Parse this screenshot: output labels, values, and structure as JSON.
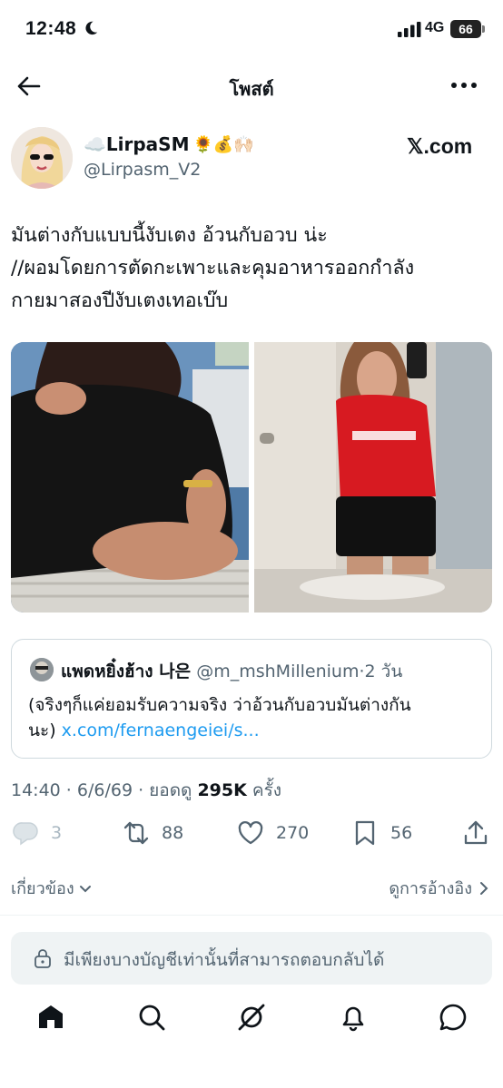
{
  "status_bar": {
    "time": "12:48",
    "network": "4G",
    "battery": "66"
  },
  "header": {
    "title": "โพสต์"
  },
  "author": {
    "name": "☁️LirpaSM",
    "name_emojis": "🌻💰🙌🏻",
    "handle": "@Lirpasm_V2"
  },
  "watermark": "𝕏.com",
  "tweet": {
    "text": "มันต่างกับแบบนี้งับเตง อ้วนกับอวบ น่ะ\n//ผอมโดยการตัดกะเพาะและคุมอาหารออกกำลัง\nกายมาสองปีงับเตงเทอเบ๊บ"
  },
  "quote": {
    "name": "แพดหยิ๋งฮ้าง 나은",
    "handle": "@m_mshMillenium",
    "separator": "·",
    "age": "2 วัน",
    "text": "(จริงๆก็แค่ยอมรับความจริง ว่าอ้วนกับอวบมันต่างกัน\nนะ) ",
    "link": "x.com/fernaengeiei/s..."
  },
  "meta": {
    "time": "14:40",
    "date": "6/6/69",
    "views_label": "ยอดดู",
    "views_count": "295K",
    "views_suffix": "ครั้ง",
    "sep": " · "
  },
  "actions": {
    "replies": "3",
    "reposts": "88",
    "likes": "270",
    "bookmarks": "56"
  },
  "related": {
    "label": "เกี่ยวข้อง",
    "quotes_label": "ดูการอ้างอิง"
  },
  "reply_box": {
    "placeholder": "มีเพียงบางบัญชีเท่านั้นที่สามารถตอบกลับได้"
  },
  "colors": {
    "text": "#0f1419",
    "muted": "#536471",
    "link": "#1d9bf0",
    "border": "#cfd9de",
    "reply_bg": "#eff3f4"
  },
  "icons": [
    "back-icon",
    "more-icon",
    "reply-icon",
    "repost-icon",
    "like-icon",
    "bookmark-icon",
    "share-icon",
    "home-icon",
    "search-icon",
    "grok-icon",
    "notifications-icon",
    "messages-icon",
    "lock-icon"
  ]
}
